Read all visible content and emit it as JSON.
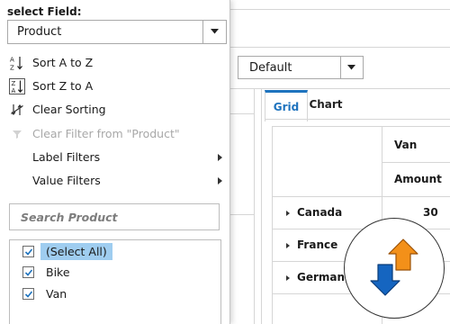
{
  "popup": {
    "title": "select Field:",
    "field_value": "Product",
    "menu": {
      "sort_az": "Sort A to Z",
      "sort_za": "Sort Z to A",
      "clear_sorting": "Clear Sorting",
      "clear_filter": "Clear Filter from \"Product\"",
      "label_filters": "Label Filters",
      "value_filters": "Value Filters"
    },
    "search_placeholder": "Search Product",
    "items": [
      {
        "label": "(Select All)",
        "checked": true
      },
      {
        "label": "Bike",
        "checked": true
      },
      {
        "label": "Van",
        "checked": true
      }
    ]
  },
  "pivot": {
    "report_value": "Default",
    "tabs": [
      "Grid",
      "Chart"
    ],
    "active_tab": "Grid",
    "column_header": "Van",
    "measure_header": "Amount",
    "rows": [
      {
        "label": "Canada",
        "value": "30"
      },
      {
        "label": "France",
        "value": ""
      },
      {
        "label": "Germany",
        "value": ""
      }
    ]
  },
  "icons": {
    "dropdown": "chevron-down-icon",
    "sort_az": "sort-ascending-icon",
    "sort_za": "sort-descending-icon",
    "clear_sorting": "clear-sort-icon",
    "clear_filter": "filter-icon",
    "submenu": "chevron-right-icon",
    "checkbox": "checkmark-icon",
    "badge": "sort-arrows-icon"
  },
  "colors": {
    "accent": "#1e73be",
    "selection": "#9fcdf0",
    "arrow_up": "#f39019",
    "arrow_down": "#1565c0"
  }
}
